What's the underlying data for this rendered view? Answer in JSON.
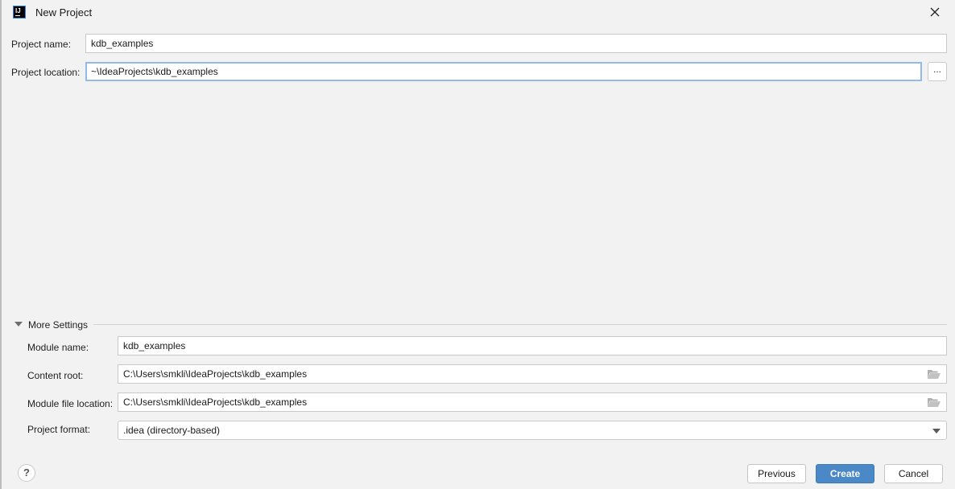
{
  "window": {
    "title": "New Project",
    "app_icon": "intellij-idea-icon",
    "close_icon": "close-icon"
  },
  "form": {
    "project_name_label": "Project name:",
    "project_name_value": "kdb_examples",
    "project_location_label": "Project location:",
    "project_location_value": "~\\IdeaProjects\\kdb_examples",
    "browse_label": "..."
  },
  "more_settings": {
    "label": "More Settings",
    "expanded": true,
    "module_name_label": "Module name:",
    "module_name_value": "kdb_examples",
    "content_root_label": "Content root:",
    "content_root_value": "C:\\Users\\smkli\\IdeaProjects\\kdb_examples",
    "module_file_location_label": "Module file location:",
    "module_file_location_value": "C:\\Users\\smkli\\IdeaProjects\\kdb_examples",
    "project_format_label": "Project format:",
    "project_format_value": ".idea (directory-based)"
  },
  "footer": {
    "help_label": "?",
    "previous_label": "Previous",
    "create_label": "Create",
    "cancel_label": "Cancel"
  },
  "colors": {
    "primary_button": "#4a88c7",
    "focus_ring": "#8fbcec",
    "background": "#f2f2f2"
  }
}
